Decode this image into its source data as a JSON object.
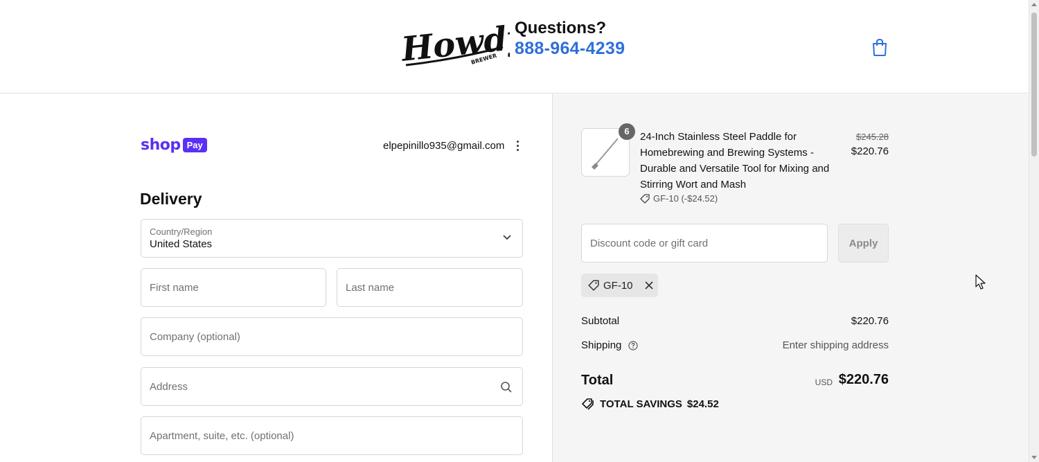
{
  "header": {
    "logo_text": "Howdy",
    "logo_subtext": "BREWER",
    "questions": "Questions?",
    "phone": "888-964-4239",
    "cart_icon": "shopping-bag-icon"
  },
  "account": {
    "shop_text": "shop",
    "pay_text": "Pay",
    "email": "elpepinillo935@gmail.com",
    "menu_icon": "kebab-menu-icon"
  },
  "delivery": {
    "title": "Delivery",
    "country_label": "Country/Region",
    "country_value": "United States",
    "first_name_placeholder": "First name",
    "last_name_placeholder": "Last name",
    "company_placeholder": "Company (optional)",
    "address_placeholder": "Address",
    "apartment_placeholder": "Apartment, suite, etc. (optional)"
  },
  "order": {
    "quantity": "6",
    "product_title": "24-Inch Stainless Steel Paddle for Homebrewing and Brewing Systems - Durable and Versatile Tool for Mixing and Stirring Wort and Mash",
    "product_discount": "GF-10 (-$24.52)",
    "original_price": "$245.28",
    "price": "$220.76",
    "discount_placeholder": "Discount code or gift card",
    "apply_label": "Apply",
    "applied_code": "GF-10",
    "subtotal_label": "Subtotal",
    "subtotal_value": "$220.76",
    "shipping_label": "Shipping",
    "shipping_value": "Enter shipping address",
    "total_label": "Total",
    "currency": "USD",
    "total_value": "$220.76",
    "savings_label": "TOTAL SAVINGS",
    "savings_value": "$24.52"
  },
  "colors": {
    "accent_blue": "#2f6fdc",
    "shop_pay_purple": "#5a31f4",
    "summary_bg": "#f5f5f5"
  }
}
